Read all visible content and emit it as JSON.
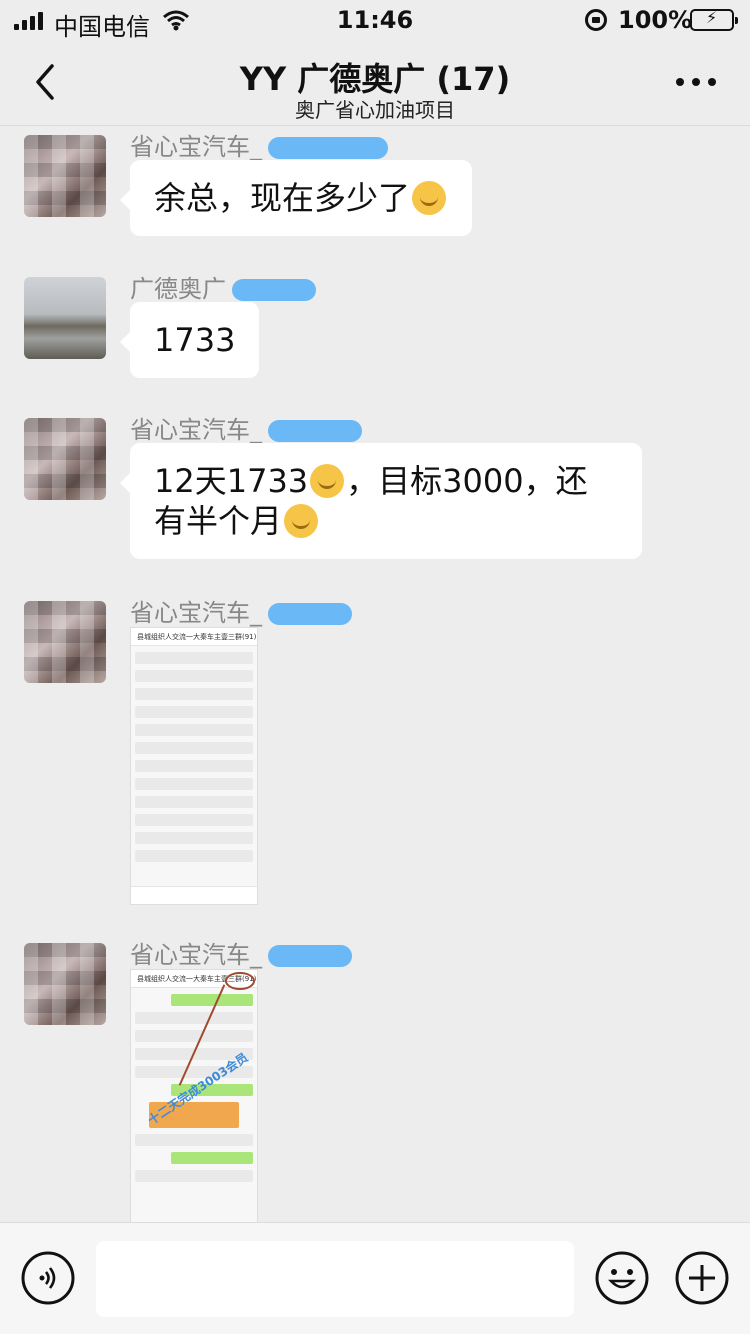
{
  "status_bar": {
    "carrier": "中国电信",
    "time": "11:46",
    "battery": "100%"
  },
  "nav": {
    "title": "YY 广德奥广 (17)",
    "subtitle": "奥广省心加油项目"
  },
  "messages": [
    {
      "sender": "省心宝汽车_",
      "text": "余总，现在多少了"
    },
    {
      "sender": "广德奥广",
      "text": "1733"
    },
    {
      "sender": "省心宝汽车_",
      "text_a": "12天1733",
      "text_b": "，目标3000，还",
      "text_c": "有半个月"
    },
    {
      "sender": "省心宝汽车_",
      "image": {
        "header": "县城组织人交流一大秦车主壹三群(91)"
      }
    },
    {
      "sender": "省心宝汽车_",
      "image": {
        "header": "县城组织人交流一大秦车主壹三群(91)",
        "annotation": "十二天完成3003会员"
      }
    }
  ],
  "input_bar": {
    "placeholder": ""
  },
  "icons": {
    "back": "chevron-left-icon",
    "more": "more-icon",
    "voice": "voice-icon",
    "emoji": "emoji-icon",
    "add": "plus-icon"
  },
  "colors": {
    "background": "#ededed",
    "bubble": "#ffffff",
    "battery_fill": "#3bc24a",
    "redaction": "#6ab8f5"
  }
}
